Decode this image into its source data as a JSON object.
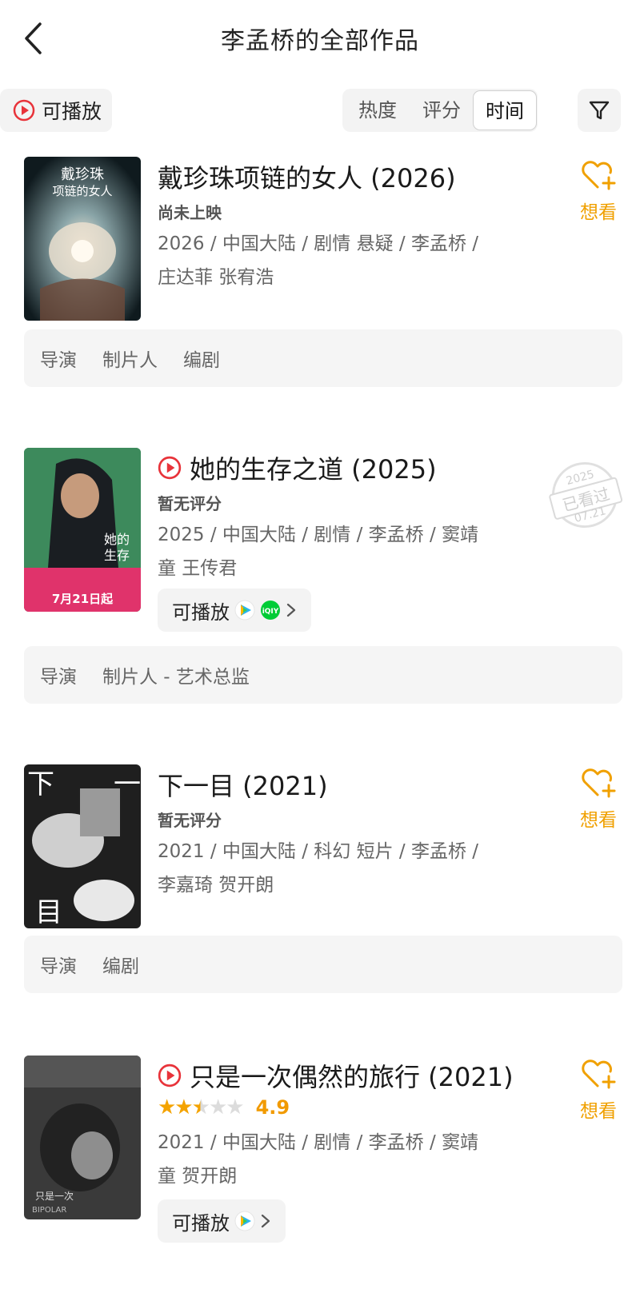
{
  "header": {
    "title": "李孟桥的全部作品"
  },
  "filters": {
    "playable": "可播放",
    "sort_options": [
      "热度",
      "评分",
      "时间"
    ],
    "selected_sort": "时间"
  },
  "colors": {
    "accent": "#f0a000",
    "play_red": "#e8333a",
    "star": "#f4a300"
  },
  "movies": [
    {
      "title": "戴珍珠项链的女人 (2026)",
      "status": "尚未上映",
      "meta_line1": "2026 / 中国大陆 / 剧情 悬疑 / 李孟桥 /",
      "meta_line2": "庄达菲 张宥浩",
      "want": "想看",
      "roles": [
        "导演",
        "制片人",
        "编剧"
      ]
    },
    {
      "title": "她的生存之道 (2025)",
      "status": "暂无评分",
      "meta_line1": "2025 / 中国大陆 / 剧情 / 李孟桥 / 窦靖",
      "meta_line2": "童 王传君",
      "stamp_year": "2025",
      "stamp_text": "已看过",
      "stamp_date": "07.21",
      "playable": "可播放",
      "poster_date": "7月21日起",
      "roles": [
        "导演",
        "制片人 - 艺术总监"
      ]
    },
    {
      "title": "下一目 (2021)",
      "status": "暂无评分",
      "meta_line1": "2021 / 中国大陆 / 科幻 短片 / 李孟桥 /",
      "meta_line2": "李嘉琦 贺开朗",
      "want": "想看",
      "roles": [
        "导演",
        "编剧"
      ]
    },
    {
      "title": "只是一次偶然的旅行 (2021)",
      "rating_value": 2.5,
      "score": "4.9",
      "meta_line1": "2021 / 中国大陆 / 剧情 / 李孟桥 / 窦靖",
      "meta_line2": "童 贺开朗",
      "want": "想看",
      "playable": "可播放"
    }
  ]
}
